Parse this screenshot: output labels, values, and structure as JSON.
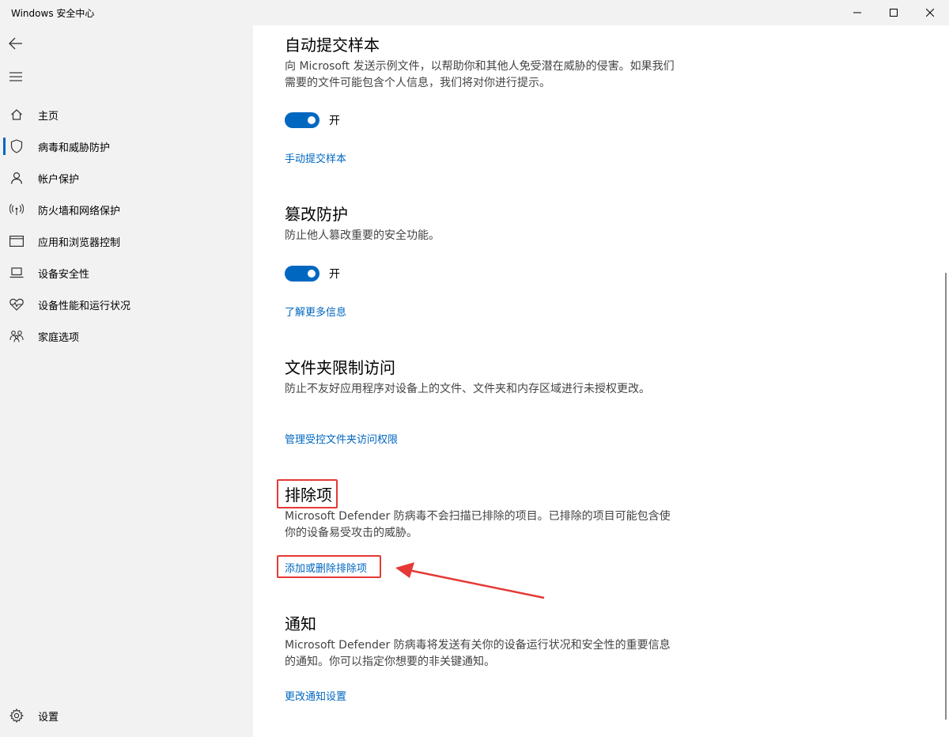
{
  "window": {
    "title": "Windows 安全中心"
  },
  "sidebar": {
    "items": [
      {
        "label": "主页",
        "icon": "home-icon"
      },
      {
        "label": "病毒和威胁防护",
        "icon": "shield-icon"
      },
      {
        "label": "帐户保护",
        "icon": "person-icon"
      },
      {
        "label": "防火墙和网络保护",
        "icon": "wifi-icon"
      },
      {
        "label": "应用和浏览器控制",
        "icon": "browser-window-icon"
      },
      {
        "label": "设备安全性",
        "icon": "laptop-icon"
      },
      {
        "label": "设备性能和运行状况",
        "icon": "heart-pulse-icon"
      },
      {
        "label": "家庭选项",
        "icon": "family-icon"
      }
    ],
    "settings_label": "设置",
    "selected_index": 1
  },
  "sections": {
    "auto_submit": {
      "title": "自动提交样本",
      "desc": "向 Microsoft 发送示例文件，以帮助你和其他人免受潜在威胁的侵害。如果我们需要的文件可能包含个人信息，我们将对你进行提示。",
      "toggle_label": "开",
      "toggle_on": true,
      "link": "手动提交样本"
    },
    "tamper": {
      "title": "篡改防护",
      "desc": "防止他人篡改重要的安全功能。",
      "toggle_label": "开",
      "toggle_on": true,
      "link": "了解更多信息"
    },
    "folder_access": {
      "title": "文件夹限制访问",
      "desc": "防止不友好应用程序对设备上的文件、文件夹和内存区域进行未授权更改。",
      "link": "管理受控文件夹访问权限"
    },
    "exclusions": {
      "title": "排除项",
      "desc": "Microsoft Defender 防病毒不会扫描已排除的项目。已排除的项目可能包含使你的设备易受攻击的威胁。",
      "link": "添加或删除排除项"
    },
    "notifications": {
      "title": "通知",
      "desc": "Microsoft Defender 防病毒将发送有关你的设备运行状况和安全性的重要信息的通知。你可以指定你想要的非关键通知。",
      "link": "更改通知设置"
    }
  },
  "colors": {
    "accent": "#0067c0",
    "annotation": "#e53935",
    "sidebar_bg": "#f2f2f2"
  }
}
